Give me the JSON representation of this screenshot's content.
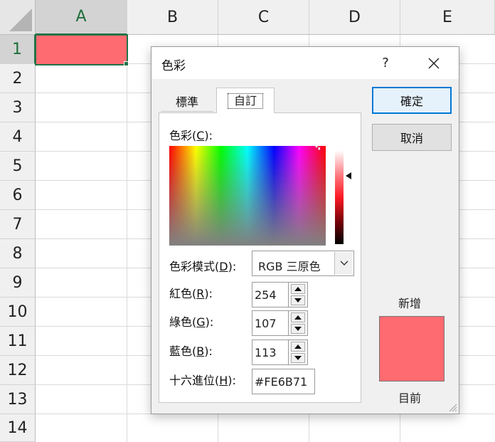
{
  "spreadsheet": {
    "columns": [
      "A",
      "B",
      "C",
      "D",
      "E"
    ],
    "rows": [
      "1",
      "2",
      "3",
      "4",
      "5",
      "6",
      "7",
      "8",
      "9",
      "10",
      "11",
      "12",
      "13",
      "14"
    ],
    "selected_cell_color": "#fe6b71"
  },
  "dialog": {
    "title": "色彩",
    "help": "?",
    "tabs": [
      "標準",
      "自訂"
    ],
    "color_label": "色彩(",
    "color_key": "C",
    "color_suffix": "):",
    "model_label": "色彩模式(",
    "model_key": "D",
    "model_suffix": "):",
    "model_value": "RGB 三原色",
    "red_label": "紅色(",
    "red_key": "R",
    "red_suffix": "):",
    "red_value": "254",
    "green_label": "綠色(",
    "green_key": "G",
    "green_suffix": "):",
    "green_value": "107",
    "blue_label": "藍色(",
    "blue_key": "B",
    "blue_suffix": "):",
    "blue_value": "113",
    "hex_label": "十六進位(",
    "hex_key": "H",
    "hex_suffix": "):",
    "hex_value": "#FE6B71",
    "ok": "確定",
    "cancel": "取消",
    "new_label": "新增",
    "current_label": "目前",
    "new_color": "#fe6b71",
    "current_color": "#fe6b71"
  }
}
